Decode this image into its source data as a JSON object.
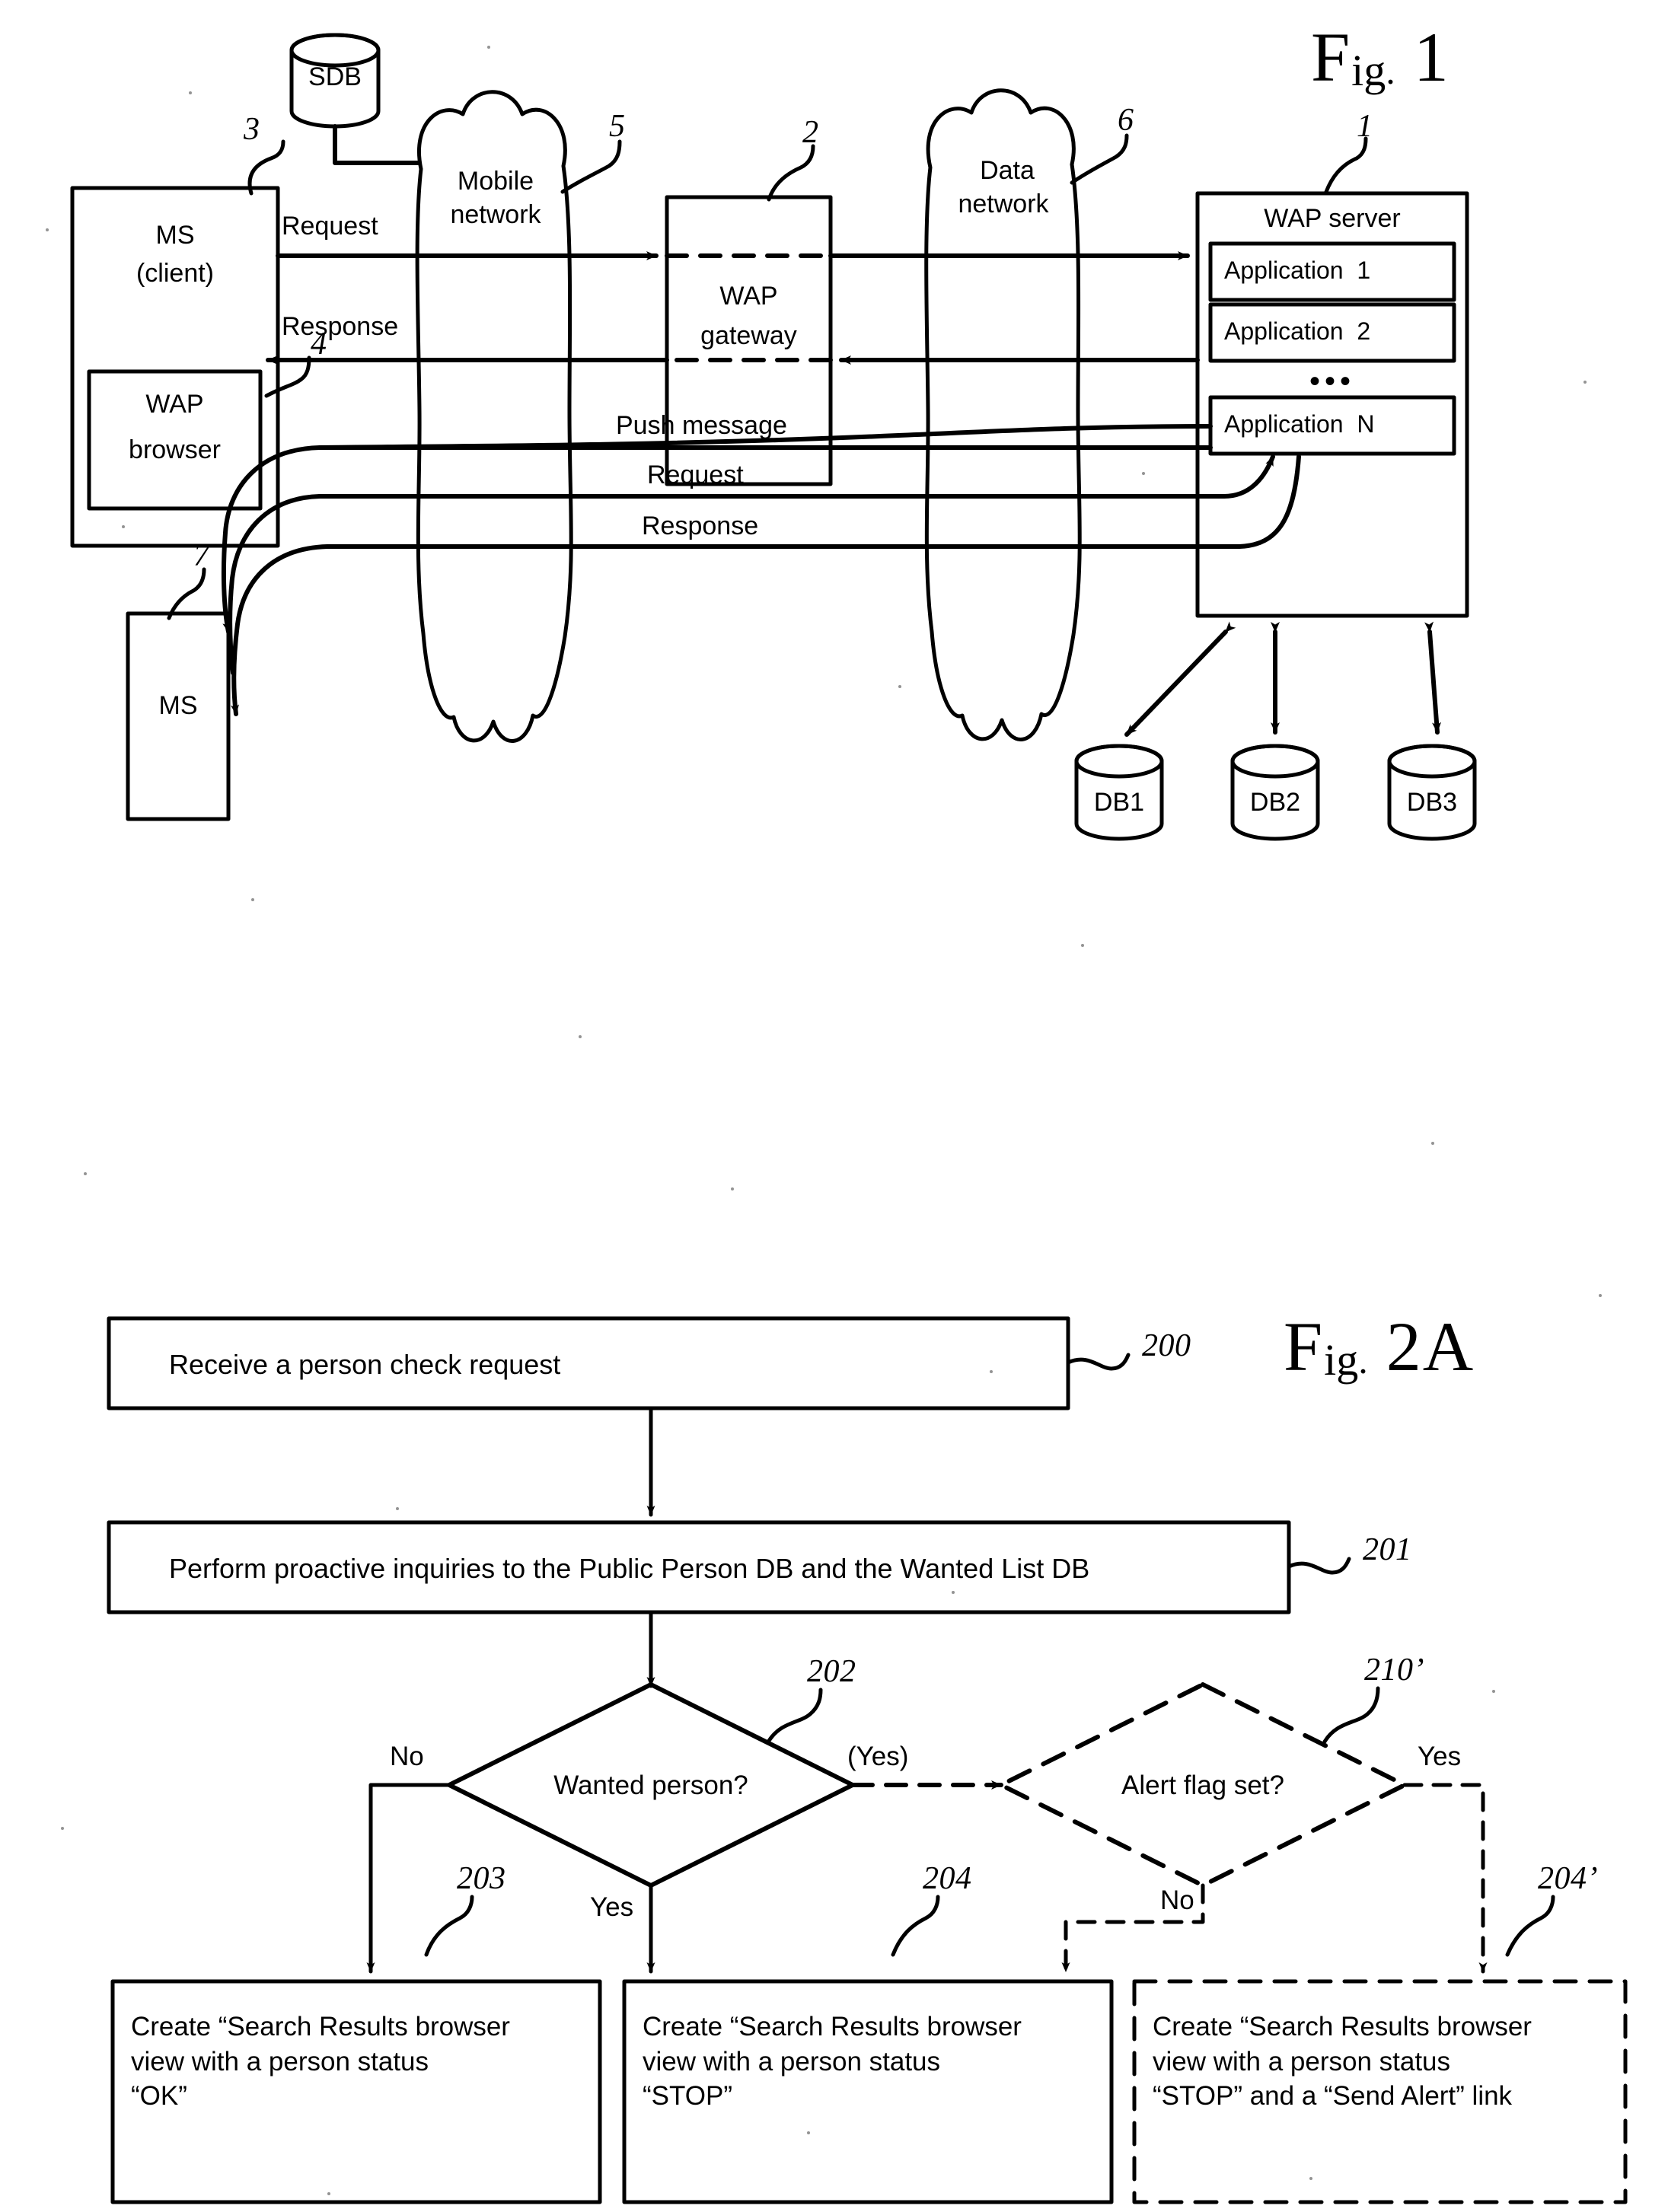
{
  "figure1": {
    "title": {
      "prefix": "F",
      "small": "ig",
      "dot": ".",
      "number": "1"
    },
    "nodes": {
      "sdb": "SDB",
      "ms_client_line1": "MS",
      "ms_client_line2": "(client)",
      "wap_browser_line1": "WAP",
      "wap_browser_line2": "browser",
      "ms_bottom": "MS",
      "mobile_network_line1": "Mobile",
      "mobile_network_line2": "network",
      "data_network_line1": "Data",
      "data_network_line2": "network",
      "wap_gateway_line1": "WAP",
      "wap_gateway_line2": "gateway",
      "wap_server": "WAP server",
      "applications": [
        "Application  1",
        "Application  2",
        "Application  N"
      ],
      "applications_ellipsis": "•••",
      "databases": [
        "DB1",
        "DB2",
        "DB3"
      ]
    },
    "flow_labels": {
      "request_top": "Request",
      "response_top": "Response",
      "push_message": "Push message",
      "request_bottom": "Request",
      "response_bottom": "Response"
    },
    "reference_numerals": {
      "wap_server": "1",
      "wap_gateway": "2",
      "ms_client": "3",
      "wap_browser": "4",
      "mobile_network": "5",
      "data_network": "6",
      "ms_bottom": "7"
    }
  },
  "figure2a": {
    "title": {
      "prefix": "F",
      "small": "ig",
      "dot": ".",
      "number": "2A"
    },
    "steps": {
      "s200": "Receive a person check request",
      "s201": "Perform proactive inquiries to the Public Person DB and the Wanted List DB",
      "s202": "Wanted person?",
      "s210p": "Alert flag set?",
      "s203": "Create “Search Results browser\nview with a person status\n“OK”",
      "s204": "Create “Search Results browser\nview with a person status\n“STOP”",
      "s204p": "Create “Search Results browser\nview with a person status\n“STOP” and a “Send Alert” link"
    },
    "branch_labels": {
      "wanted_no": "No",
      "wanted_yes_paren": "(Yes)",
      "wanted_yes": "Yes",
      "alert_yes": "Yes",
      "alert_no": "No"
    },
    "reference_numerals": {
      "s200": "200",
      "s201": "201",
      "s202": "202",
      "s203": "203",
      "s204": "204",
      "s204p": "204’",
      "s210p": "210’"
    }
  },
  "style": {
    "ink": "#000000",
    "paper": "#ffffff"
  }
}
